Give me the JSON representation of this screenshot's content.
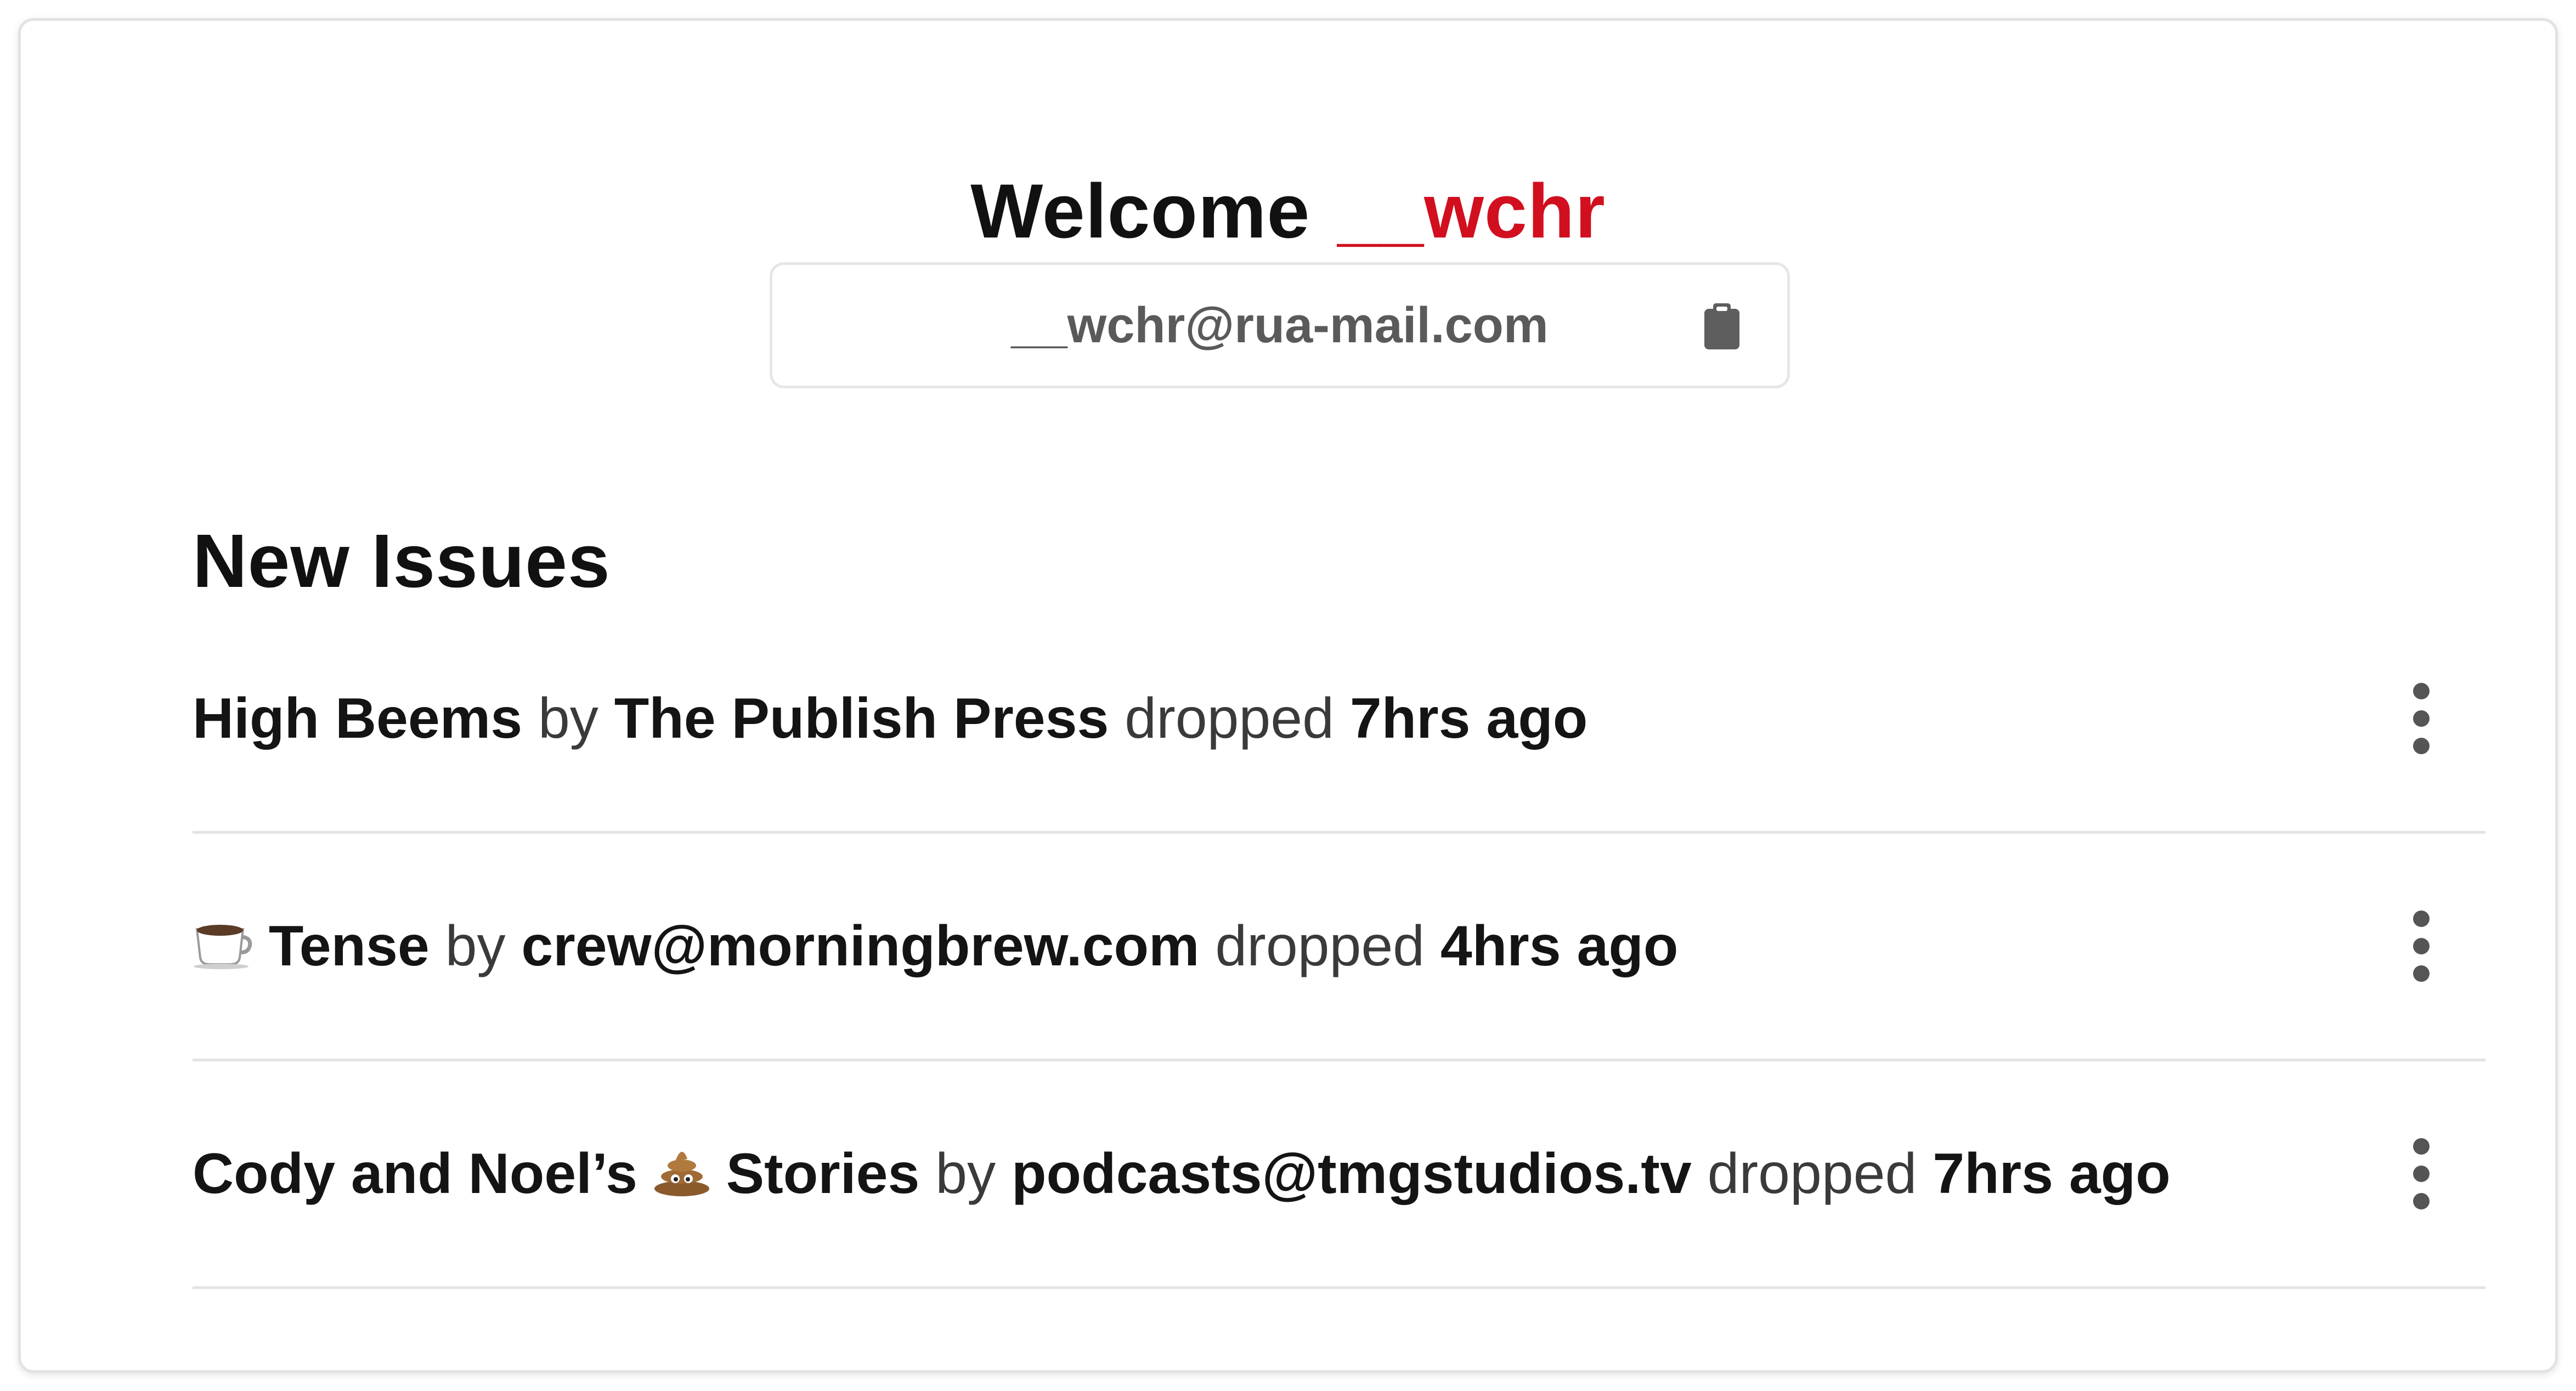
{
  "welcome": {
    "greeting": "Welcome",
    "username": "__wchr",
    "username_color": "#d10f1f"
  },
  "email": {
    "value": "__wchr@rua-mail.com",
    "copy_icon": "clipboard-icon"
  },
  "new_issues": {
    "title": "New Issues",
    "items": [
      {
        "emoji": "",
        "title": "High Beems",
        "by_word": "by",
        "author": "The Publish Press",
        "dropped_word": "dropped",
        "time": "7hrs ago",
        "menu_icon": "more-vertical-icon"
      },
      {
        "emoji": "coffee-icon",
        "title": "Tense",
        "by_word": "by",
        "author": "crew@morningbrew.com",
        "dropped_word": "dropped",
        "time": "4hrs ago",
        "menu_icon": "more-vertical-icon"
      },
      {
        "emoji": "poop-icon",
        "title_before": "Cody and Noel’s",
        "title_after": "Stories",
        "by_word": "by",
        "author": "podcasts@tmgstudios.tv",
        "dropped_word": "dropped",
        "time": "7hrs ago",
        "menu_icon": "more-vertical-icon"
      }
    ]
  }
}
